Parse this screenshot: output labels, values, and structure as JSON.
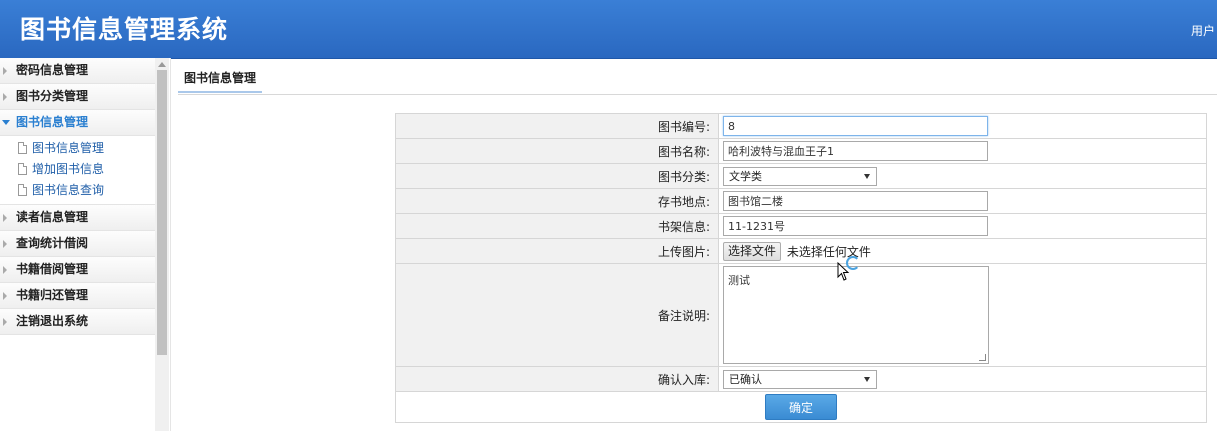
{
  "header": {
    "title": "图书信息管理系统",
    "user_text": "用户"
  },
  "sidebar": {
    "groups": [
      {
        "label": "密码信息管理"
      },
      {
        "label": "图书分类管理"
      },
      {
        "label": "图书信息管理",
        "open": true,
        "items": [
          {
            "label": "图书信息管理"
          },
          {
            "label": "增加图书信息"
          },
          {
            "label": "图书信息查询"
          }
        ]
      },
      {
        "label": "读者信息管理"
      },
      {
        "label": "查询统计借阅"
      },
      {
        "label": "书籍借阅管理"
      },
      {
        "label": "书籍归还管理"
      },
      {
        "label": "注销退出系统"
      }
    ]
  },
  "tab": {
    "label": "图书信息管理"
  },
  "form": {
    "book_id": {
      "label": "图书编号:",
      "value": "8"
    },
    "book_name": {
      "label": "图书名称:",
      "value": "哈利波特与混血王子1"
    },
    "category": {
      "label": "图书分类:",
      "value": "文学类"
    },
    "location": {
      "label": "存书地点:",
      "value": "图书馆二楼"
    },
    "shelf": {
      "label": "书架信息:",
      "value": "11-1231号"
    },
    "image": {
      "label": "上传图片:",
      "button": "选择文件",
      "status": "未选择任何文件"
    },
    "remark": {
      "label": "备注说明:",
      "value": "测试"
    },
    "confirm": {
      "label": "确认入库:",
      "value": "已确认"
    },
    "submit": {
      "label": "确定"
    }
  },
  "colors": {
    "header_bg": "#2f72cb",
    "accent": "#2a7fd0",
    "submit_bg": "#4a9bdc"
  }
}
